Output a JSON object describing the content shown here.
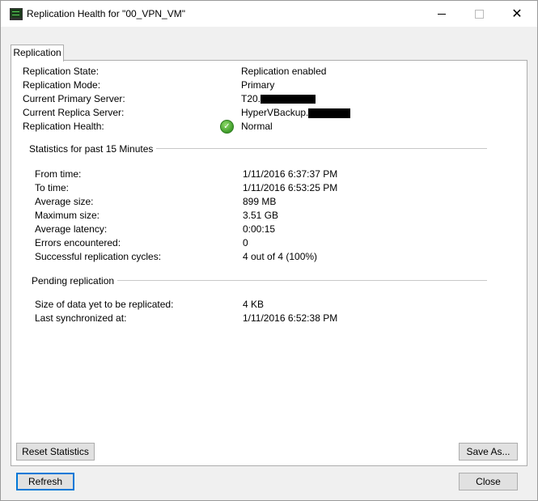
{
  "window": {
    "title": "Replication Health for \"00_VPN_VM\"",
    "controls": {
      "minimize": "",
      "maximize": "",
      "close": "✕"
    }
  },
  "tab": {
    "label": "Replication"
  },
  "summary": {
    "state_label": "Replication State:",
    "state_value": "Replication enabled",
    "mode_label": "Replication Mode:",
    "mode_value": "Primary",
    "primary_label": "Current Primary Server:",
    "primary_value": "T20.",
    "replica_label": "Current Replica Server:",
    "replica_value": "HyperVBackup.",
    "health_label": "Replication Health:",
    "health_value": "Normal"
  },
  "statistics": {
    "title": "Statistics for past 15 Minutes",
    "rows": [
      {
        "label": "From time:",
        "value": "1/11/2016 6:37:37 PM"
      },
      {
        "label": "To time:",
        "value": "1/11/2016 6:53:25 PM"
      },
      {
        "label": "Average size:",
        "value": "899 MB"
      },
      {
        "label": "Maximum size:",
        "value": "3.51 GB"
      },
      {
        "label": "Average latency:",
        "value": "0:00:15"
      },
      {
        "label": "Errors encountered:",
        "value": "0"
      },
      {
        "label": "Successful replication cycles:",
        "value": "4 out of 4 (100%)"
      }
    ]
  },
  "pending": {
    "title": "Pending replication",
    "rows": [
      {
        "label": "Size of data yet to be replicated:",
        "value": "4 KB"
      },
      {
        "label": "Last synchronized at:",
        "value": "1/11/2016 6:52:38 PM"
      }
    ]
  },
  "buttons": {
    "reset": "Reset Statistics",
    "save_as": "Save As...",
    "refresh": "Refresh",
    "close": "Close"
  }
}
